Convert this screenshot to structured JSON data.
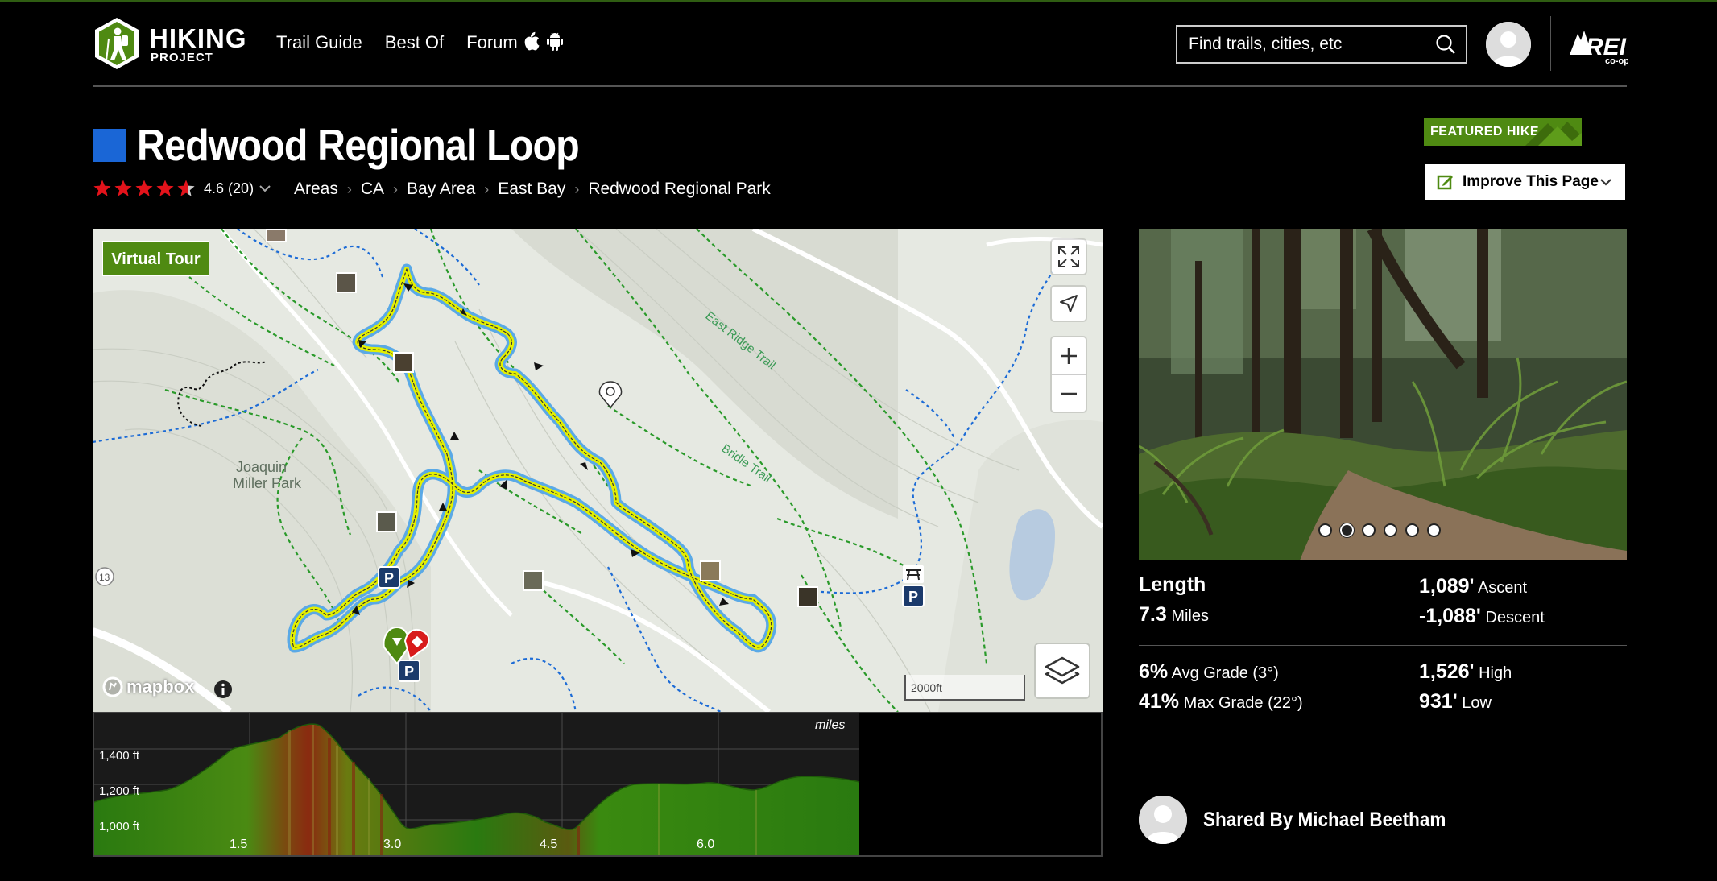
{
  "brand": {
    "line1": "HIKING",
    "line2": "PROJECT"
  },
  "nav": {
    "trail_guide": "Trail Guide",
    "best_of": "Best Of",
    "forum": "Forum"
  },
  "search": {
    "placeholder": "Find trails, cities, etc"
  },
  "rei": {
    "text": "REI",
    "sub": "co-op"
  },
  "trail": {
    "title": "Redwood Regional Loop",
    "difficulty_color": "#1a66d6",
    "rating": "4.6",
    "rating_count": "(20)",
    "stars": 4.6
  },
  "breadcrumbs": [
    "Areas",
    "CA",
    "Bay Area",
    "East Bay",
    "Redwood Regional Park"
  ],
  "featured_badge": "FEATURED HIKE",
  "improve_button": "Improve This Page",
  "map": {
    "virtual_tour": "Virtual Tour",
    "labels": {
      "park": "Joaquin",
      "park2": "Miller Park",
      "east_ridge": "East Ridge Trail",
      "bridle": "Bridle Trail",
      "road": "13"
    },
    "scale": "2000ft",
    "attribution": "mapbox"
  },
  "elevation": {
    "unit_label": "miles",
    "y_ticks": [
      "1,400 ft",
      "1,200 ft",
      "1,000 ft"
    ],
    "x_ticks": [
      "1.5",
      "3.0",
      "4.5",
      "6.0"
    ]
  },
  "photo": {
    "dots": 6,
    "active_dot": 1
  },
  "stats": {
    "length_label": "Length",
    "length_value": "7.3",
    "length_unit": "Miles",
    "ascent_value": "1,089'",
    "ascent_label": "Ascent",
    "descent_value": "-1,088'",
    "descent_label": "Descent",
    "avg_grade_value": "6%",
    "avg_grade_label": "Avg Grade (3°)",
    "max_grade_value": "41%",
    "max_grade_label": "Max Grade (22°)",
    "high_value": "1,526'",
    "high_label": "High",
    "low_value": "931'",
    "low_label": "Low"
  },
  "shared_by": "Shared By Michael Beetham",
  "colors": {
    "accent_green": "#4f8a12",
    "route_yellow": "#e4f000",
    "route_blue": "#5aa9e6"
  }
}
